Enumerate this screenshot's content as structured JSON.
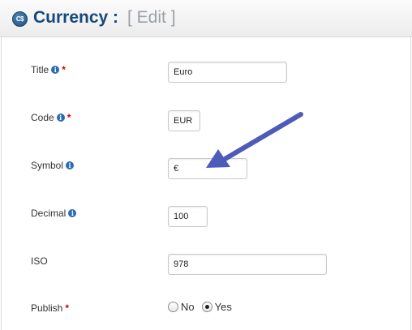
{
  "header": {
    "icon": "currency-logo-icon",
    "icon_text": "C$",
    "title": "Currency :",
    "subtitle": "[ Edit ]"
  },
  "form": {
    "fields": [
      {
        "label": "Title",
        "required": "*",
        "value": "Euro"
      },
      {
        "label": "Code",
        "required": "*",
        "value": "EUR"
      },
      {
        "label": "Symbol",
        "required": "",
        "value": "€"
      },
      {
        "label": "Decimal",
        "required": "",
        "value": "100"
      },
      {
        "label": "ISO",
        "required": "",
        "value": "978"
      }
    ],
    "publish": {
      "label": "Publish",
      "required": "*",
      "options": [
        {
          "label": "No",
          "selected": false
        },
        {
          "label": "Yes",
          "selected": true
        }
      ]
    }
  },
  "annotation": {
    "arrow_color": "#4f5bb8",
    "points_to": "symbol-input"
  },
  "colors": {
    "title": "#14497c",
    "subtitle": "#9aa0a6",
    "required": "#cc0000",
    "info": "#2c6bb3"
  }
}
